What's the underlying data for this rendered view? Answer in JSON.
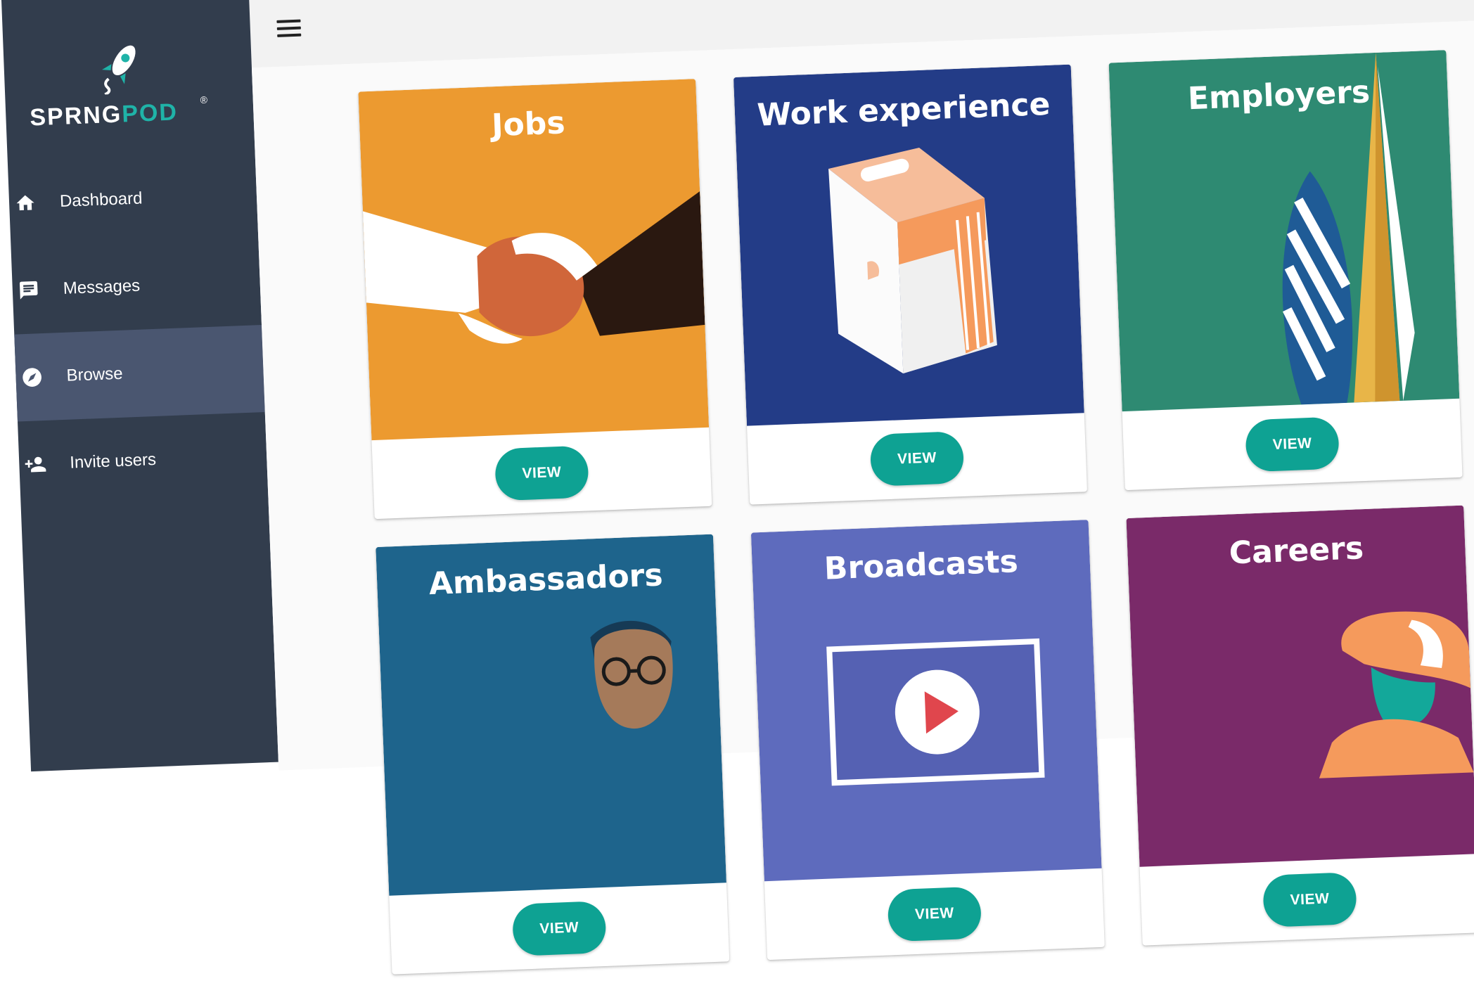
{
  "brand": {
    "logo_part1": "SPR",
    "logo_part2": "NG",
    "logo_part3": "POD",
    "registered": "®"
  },
  "sidebar": {
    "items": [
      {
        "label": "Dashboard",
        "icon": "home-icon",
        "active": false
      },
      {
        "label": "Messages",
        "icon": "message-icon",
        "active": false
      },
      {
        "label": "Browse",
        "icon": "compass-icon",
        "active": true
      },
      {
        "label": "Invite users",
        "icon": "add-user-icon",
        "active": false
      }
    ]
  },
  "topbar": {
    "menu_icon": "hamburger-icon"
  },
  "cards": [
    {
      "title": "Jobs",
      "button": "VIEW",
      "color": "#ec9a30",
      "illustration": "handshake"
    },
    {
      "title": "Work experience",
      "button": "VIEW",
      "color": "#233c87",
      "illustration": "briefcase"
    },
    {
      "title": "Employers",
      "button": "VIEW",
      "color": "#2e8a72",
      "illustration": "skyscrapers"
    },
    {
      "title": "Ambassadors",
      "button": "VIEW",
      "color": "#1e648c",
      "illustration": "person-with-glasses"
    },
    {
      "title": "Broadcasts",
      "button": "VIEW",
      "color": "#5e6bbd",
      "illustration": "video-player"
    },
    {
      "title": "Careers",
      "button": "VIEW",
      "color": "#7a2a69",
      "illustration": "vr-headset"
    }
  ],
  "colors": {
    "sidebar_bg": "#323d4d",
    "sidebar_active": "#4a5670",
    "accent": "#0ea293"
  }
}
